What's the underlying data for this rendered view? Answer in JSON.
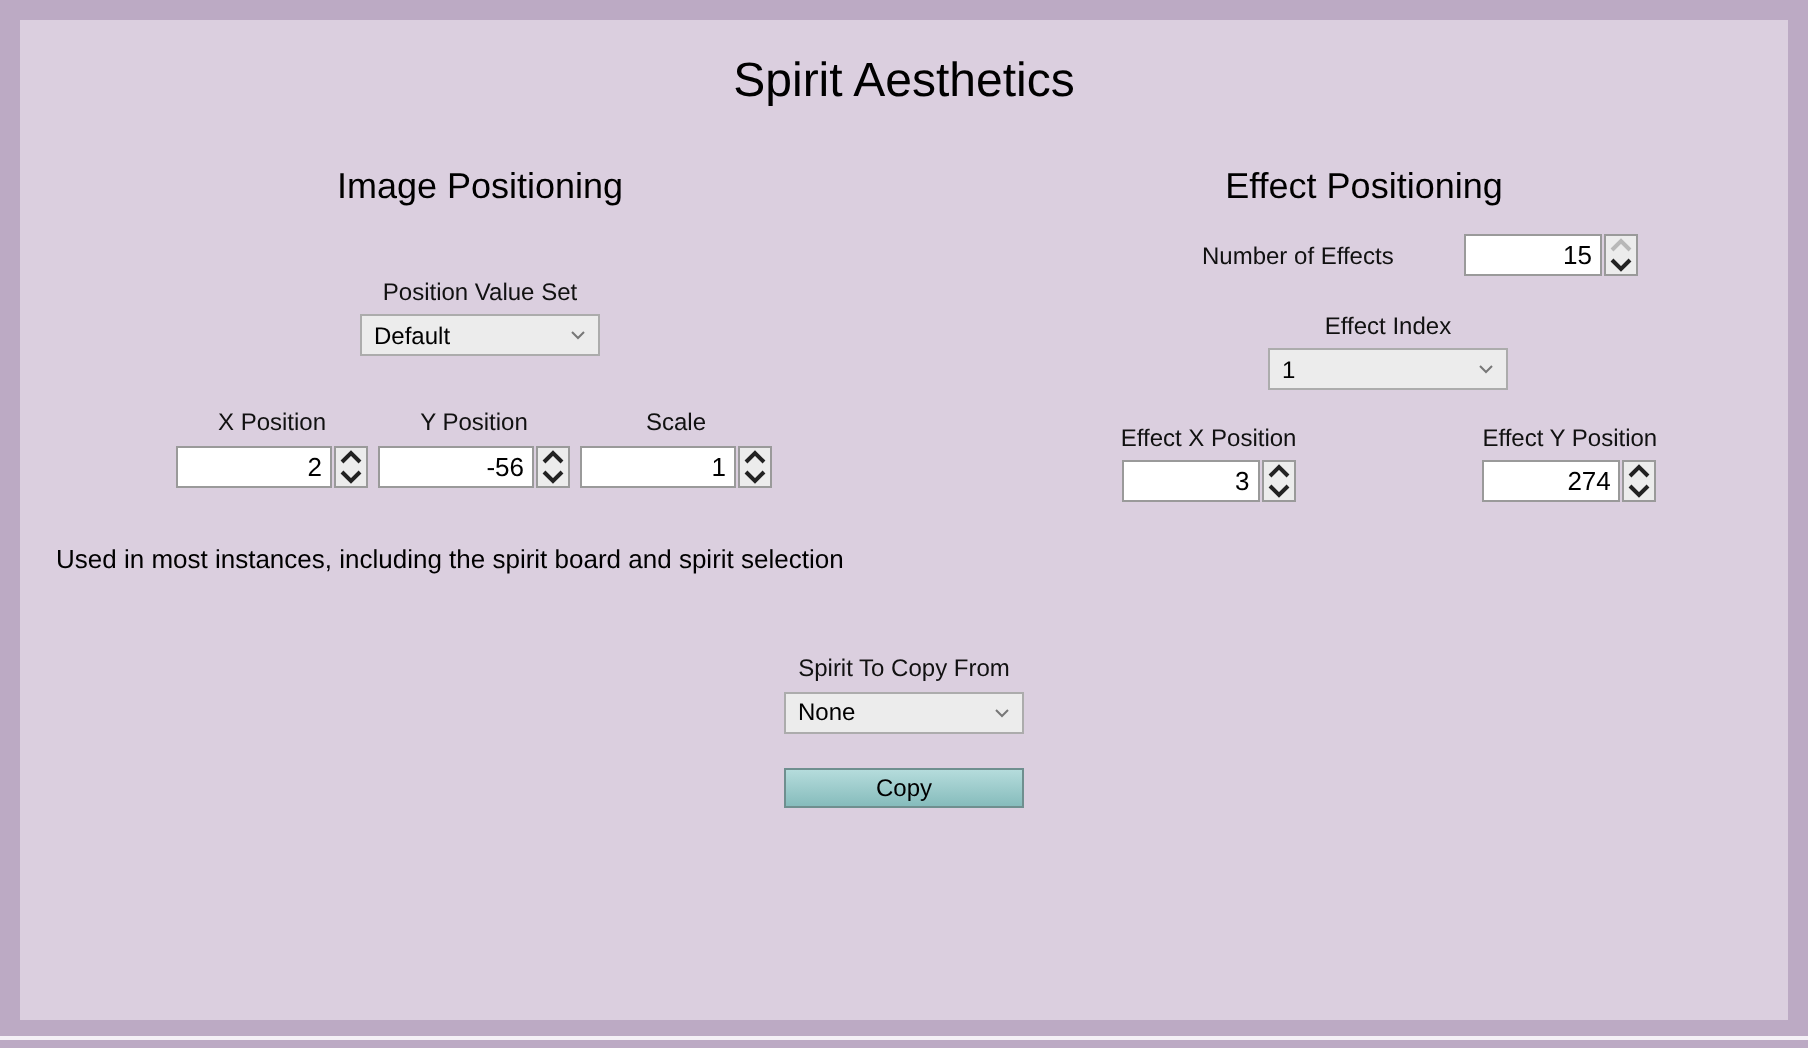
{
  "window": {
    "title": "Spirit Aesthetics"
  },
  "image_positioning": {
    "heading": "Image Positioning",
    "value_set": {
      "label": "Position Value Set",
      "value": "Default"
    },
    "fields": [
      {
        "label": "X Position",
        "value": "2",
        "up_disabled": false
      },
      {
        "label": "Y Position",
        "value": "-56",
        "up_disabled": false
      },
      {
        "label": "Scale",
        "value": "1",
        "up_disabled": false
      }
    ],
    "note": "Used in most instances, including the spirit board and spirit selection"
  },
  "effect_positioning": {
    "heading": "Effect Positioning",
    "number_of_effects": {
      "label": "Number of Effects",
      "value": "15",
      "up_disabled": true
    },
    "effect_index": {
      "label": "Effect Index",
      "value": "1"
    },
    "fields": [
      {
        "label": "Effect X Position",
        "value": "3",
        "up_disabled": false
      },
      {
        "label": "Effect Y Position",
        "value": "274",
        "up_disabled": false
      }
    ]
  },
  "copy": {
    "label": "Spirit To Copy From",
    "value": "None",
    "button": "Copy"
  }
}
